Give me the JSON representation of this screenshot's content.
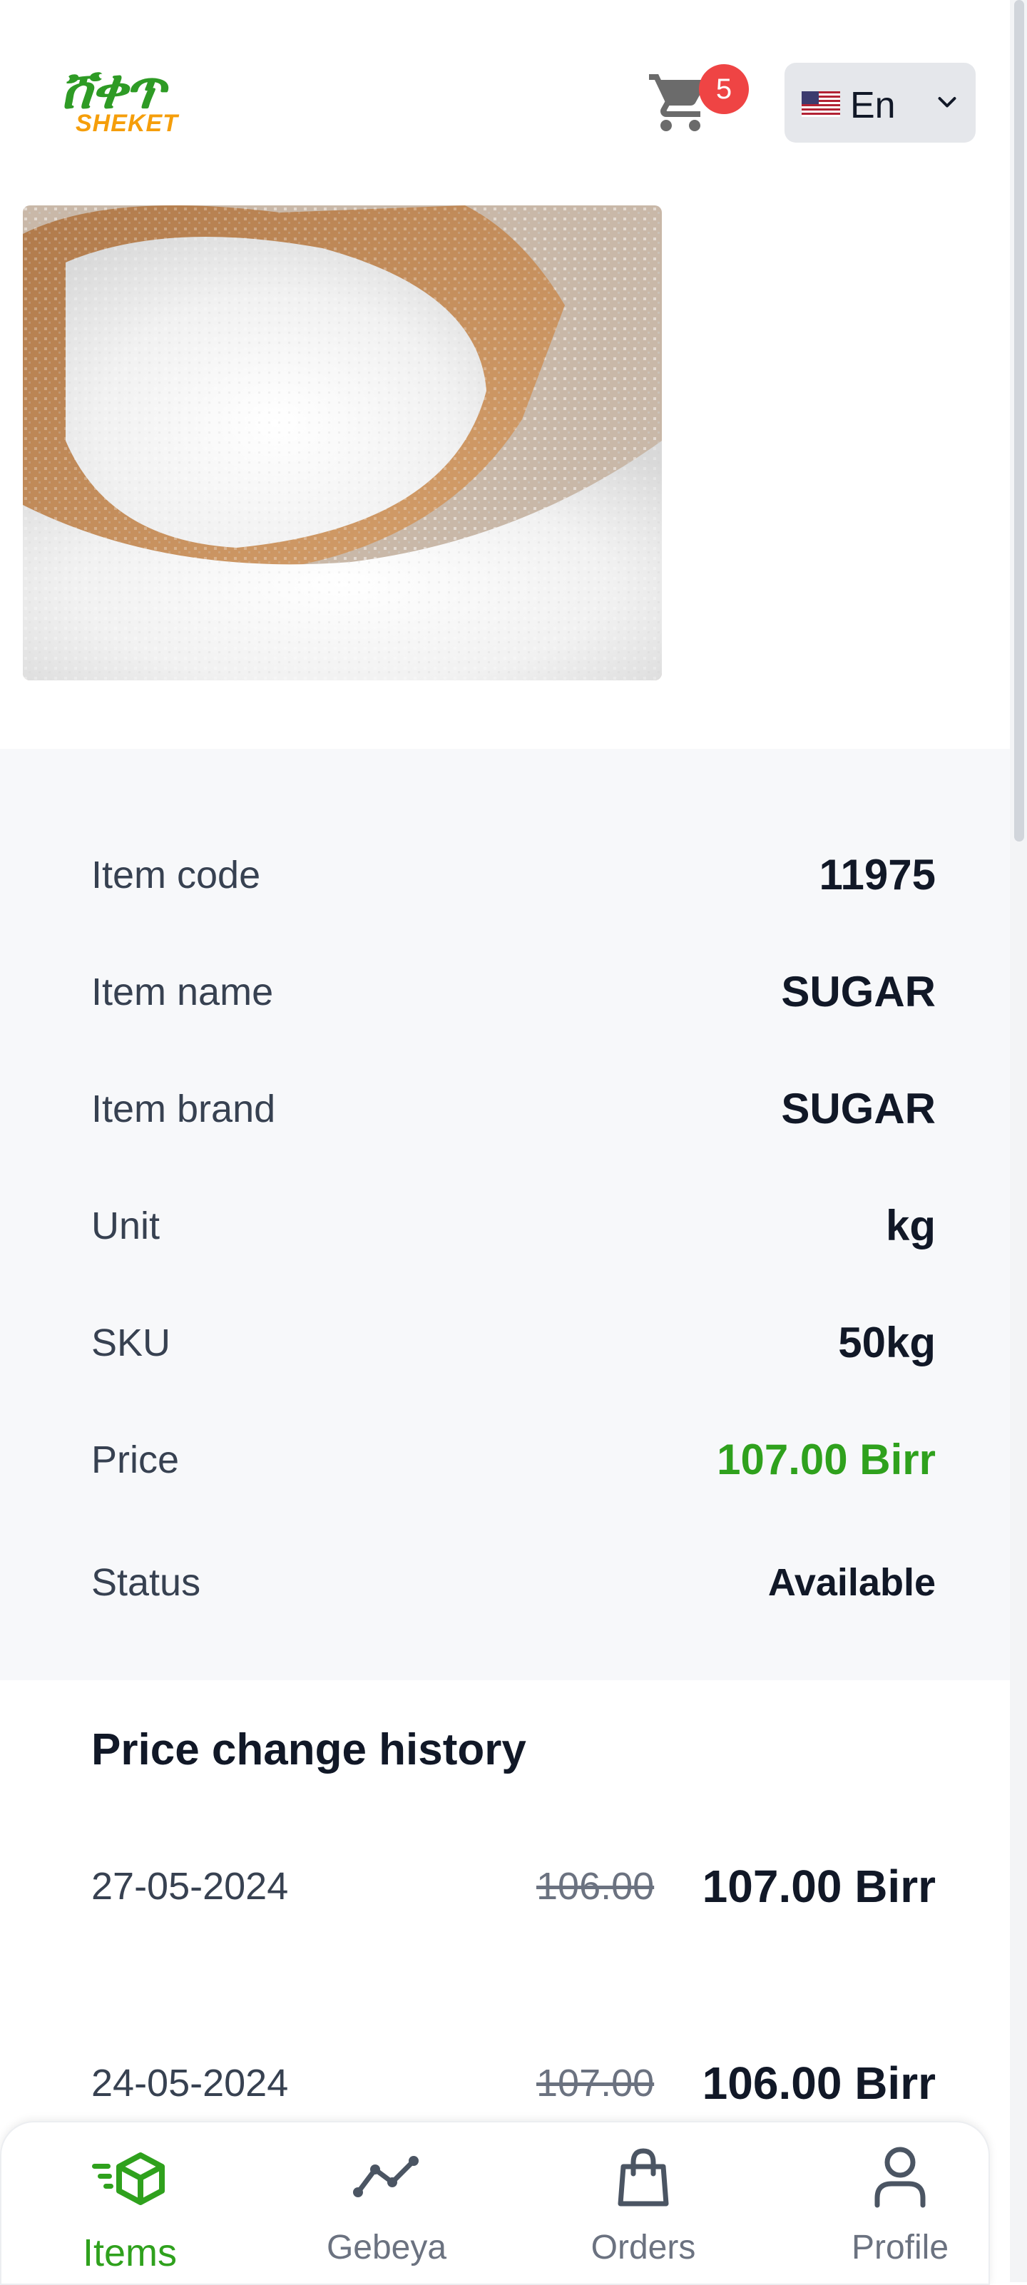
{
  "header": {
    "logo_amharic": "ሸቀጥ",
    "logo_latin": "SHEKET",
    "cart_count": "5",
    "language": "En"
  },
  "product": {
    "image_alt": "sugar-image"
  },
  "details": {
    "rows": [
      {
        "label": "Item code",
        "value": "11975"
      },
      {
        "label": "Item name",
        "value": "SUGAR"
      },
      {
        "label": "Item brand",
        "value": "SUGAR"
      },
      {
        "label": "Unit",
        "value": "kg"
      },
      {
        "label": "SKU",
        "value": "50kg"
      },
      {
        "label": "Price",
        "value": "107.00 Birr"
      },
      {
        "label": "Status",
        "value": "Available"
      }
    ]
  },
  "history": {
    "title": "Price change history",
    "rows": [
      {
        "date": "27-05-2024",
        "old": "106.00",
        "new": "107.00 Birr"
      },
      {
        "date": "24-05-2024",
        "old": "107.00",
        "new": "106.00 Birr"
      }
    ]
  },
  "nav": {
    "items": [
      {
        "label": "Items",
        "icon": "items-icon"
      },
      {
        "label": "Gebeya",
        "icon": "chart-line-icon"
      },
      {
        "label": "Orders",
        "icon": "shopping-bag-icon"
      },
      {
        "label": "Profile",
        "icon": "user-icon"
      }
    ]
  },
  "colors": {
    "accent_green": "#2fa11d",
    "badge_red": "#ef4444",
    "logo_orange": "#f59e0b"
  }
}
